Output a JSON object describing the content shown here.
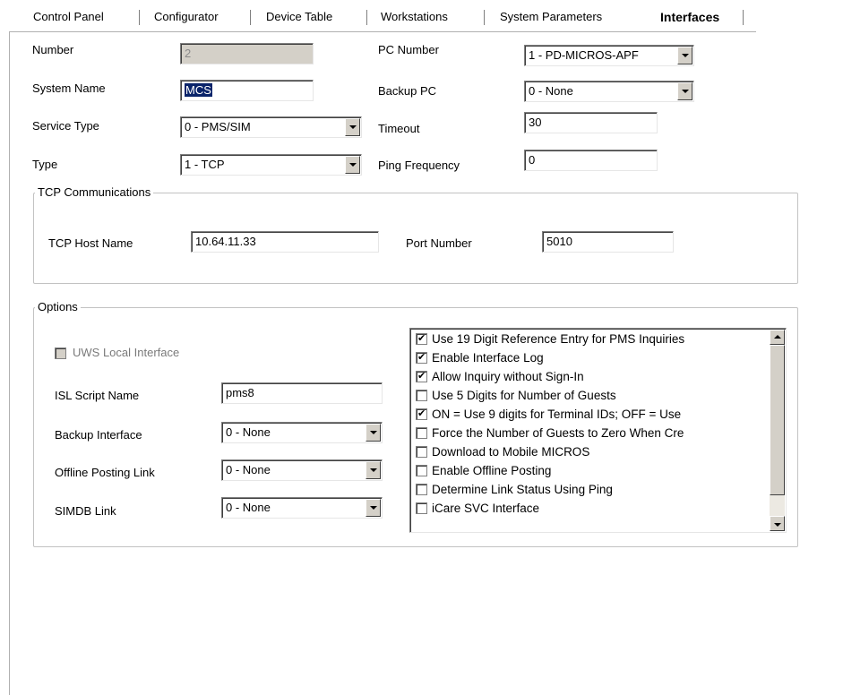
{
  "tabs": [
    {
      "label": "Control Panel"
    },
    {
      "label": "Configurator"
    },
    {
      "label": "Device Table"
    },
    {
      "label": "Workstations"
    },
    {
      "label": "System Parameters"
    },
    {
      "label": "Interfaces",
      "active": true
    }
  ],
  "form": {
    "number": {
      "label": "Number",
      "value": "2"
    },
    "system_name": {
      "label": "System Name",
      "value": "MCS"
    },
    "service_type": {
      "label": "Service Type",
      "value": "0 - PMS/SIM"
    },
    "type": {
      "label": "Type",
      "value": "1 - TCP"
    },
    "pc_number": {
      "label": "PC Number",
      "value": "1 - PD-MICROS-APF"
    },
    "backup_pc": {
      "label": "Backup PC",
      "value": "0 - None"
    },
    "timeout": {
      "label": "Timeout",
      "value": "30"
    },
    "ping_frequency": {
      "label": "Ping Frequency",
      "value": "0"
    }
  },
  "tcp": {
    "title": "TCP Communications",
    "host_label": "TCP Host Name",
    "host_value": "10.64.11.33",
    "port_label": "Port Number",
    "port_value": "5010"
  },
  "options": {
    "title": "Options",
    "uws_local_label": "UWS Local Interface",
    "uws_local_checked": false,
    "isl_label": "ISL Script Name",
    "isl_value": "pms8",
    "backup_interface_label": "Backup Interface",
    "backup_interface_value": "0 - None",
    "offline_posting_label": "Offline Posting Link",
    "offline_posting_value": "0 - None",
    "simdb_label": "SIMDB Link",
    "simdb_value": "0 - None",
    "flags": [
      {
        "label": "Use 19 Digit Reference Entry for PMS Inquiries",
        "checked": true
      },
      {
        "label": "Enable Interface Log",
        "checked": true
      },
      {
        "label": "Allow Inquiry without Sign-In",
        "checked": true
      },
      {
        "label": "Use 5 Digits for Number of Guests",
        "checked": false
      },
      {
        "label": "ON = Use 9 digits for Terminal IDs; OFF = Use",
        "checked": true
      },
      {
        "label": "Force the Number of Guests to Zero When Cre",
        "checked": false
      },
      {
        "label": "Download to Mobile MICROS",
        "checked": false
      },
      {
        "label": "Enable Offline Posting",
        "checked": false
      },
      {
        "label": "Determine Link Status Using Ping",
        "checked": false
      },
      {
        "label": "iCare SVC Interface",
        "checked": false
      }
    ]
  },
  "icons": {
    "check": "✔",
    "dropdown": "chevron-down-icon",
    "scroll_up": "arrow-up-icon",
    "scroll_down": "arrow-down-icon"
  },
  "colors": {
    "selection": "#0a246a",
    "control_face": "#d4d0c8",
    "disabled_text": "#8a8a8a"
  }
}
